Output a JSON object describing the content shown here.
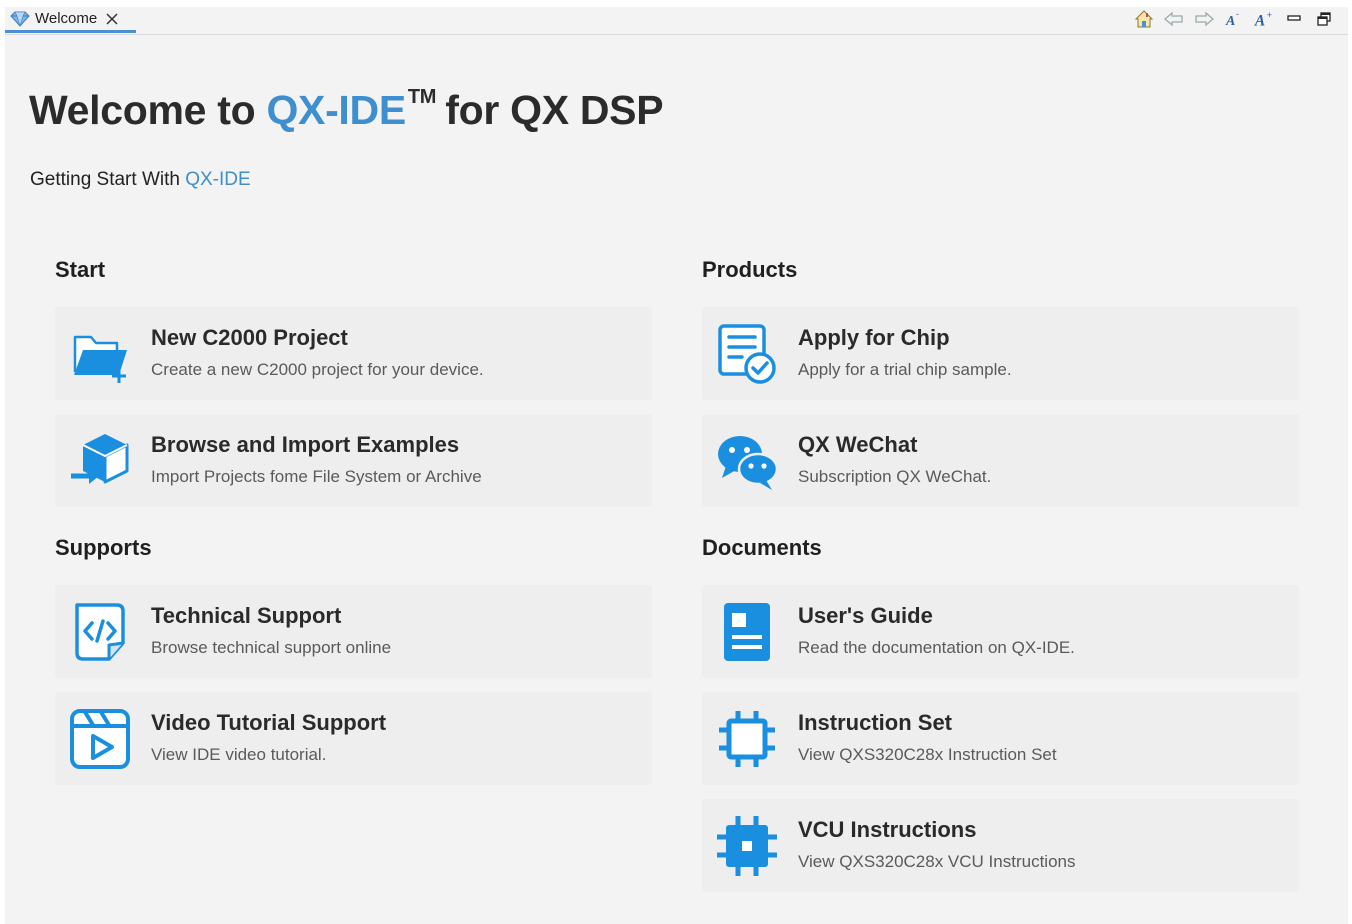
{
  "tab": {
    "label": "Welcome"
  },
  "toolbar": {
    "icons": [
      "home-icon",
      "back-icon",
      "forward-icon",
      "decrease-font-icon",
      "increase-font-icon",
      "minimize-icon",
      "restore-icon"
    ]
  },
  "header": {
    "title_prefix": "Welcome to ",
    "title_accent": "QX-IDE",
    "title_tm": "TM",
    "title_suffix": " for QX DSP",
    "subtitle_prefix": "Getting Start With ",
    "subtitle_accent": "QX-IDE"
  },
  "colors": {
    "accent": "#3d8fd0",
    "icon_blue": "#1a8fe0",
    "card_bg": "#eeeeee",
    "page_bg": "#f3f3f3"
  },
  "sections": {
    "start": {
      "title": "Start",
      "items": [
        {
          "title": "New C2000 Project",
          "desc": "Create a new C2000 project for your device.",
          "icon": "new-folder-icon"
        },
        {
          "title": "Browse and Import Examples",
          "desc": "Import Projects fome File System or Archive",
          "icon": "import-box-icon"
        }
      ]
    },
    "supports": {
      "title": "Supports",
      "items": [
        {
          "title": "Technical Support",
          "desc": "Browse technical support online",
          "icon": "code-document-icon"
        },
        {
          "title": "Video Tutorial Support",
          "desc": "View IDE video tutorial.",
          "icon": "video-play-icon"
        }
      ]
    },
    "products": {
      "title": "Products",
      "items": [
        {
          "title": "Apply for Chip",
          "desc": "Apply for a trial chip sample.",
          "icon": "application-form-icon"
        },
        {
          "title": "QX WeChat",
          "desc": "Subscription QX WeChat.",
          "icon": "wechat-icon"
        }
      ]
    },
    "documents": {
      "title": "Documents",
      "items": [
        {
          "title": "User's Guide",
          "desc": "Read the documentation on QX-IDE.",
          "icon": "book-icon"
        },
        {
          "title": "Instruction Set",
          "desc": "View QXS320C28x Instruction Set",
          "icon": "chip-outline-icon"
        },
        {
          "title": "VCU Instructions",
          "desc": "View QXS320C28x VCU Instructions",
          "icon": "chip-filled-icon"
        }
      ]
    }
  }
}
